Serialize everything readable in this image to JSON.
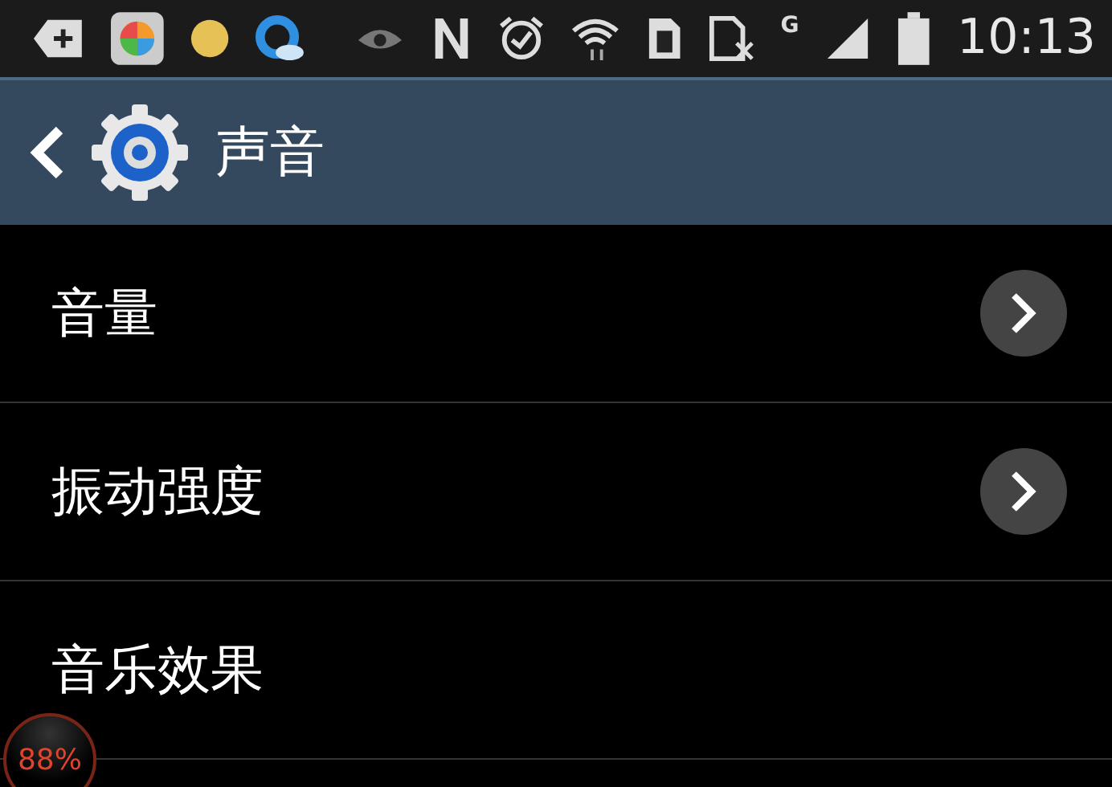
{
  "status_bar": {
    "network_label": "G",
    "time": "10:13"
  },
  "header": {
    "title": "声音"
  },
  "rows": [
    {
      "label": "音量",
      "kind": "link"
    },
    {
      "label": "振动强度",
      "kind": "link"
    },
    {
      "label": "音乐效果",
      "kind": "plain"
    }
  ],
  "floating_widget": {
    "reading": "88%"
  }
}
